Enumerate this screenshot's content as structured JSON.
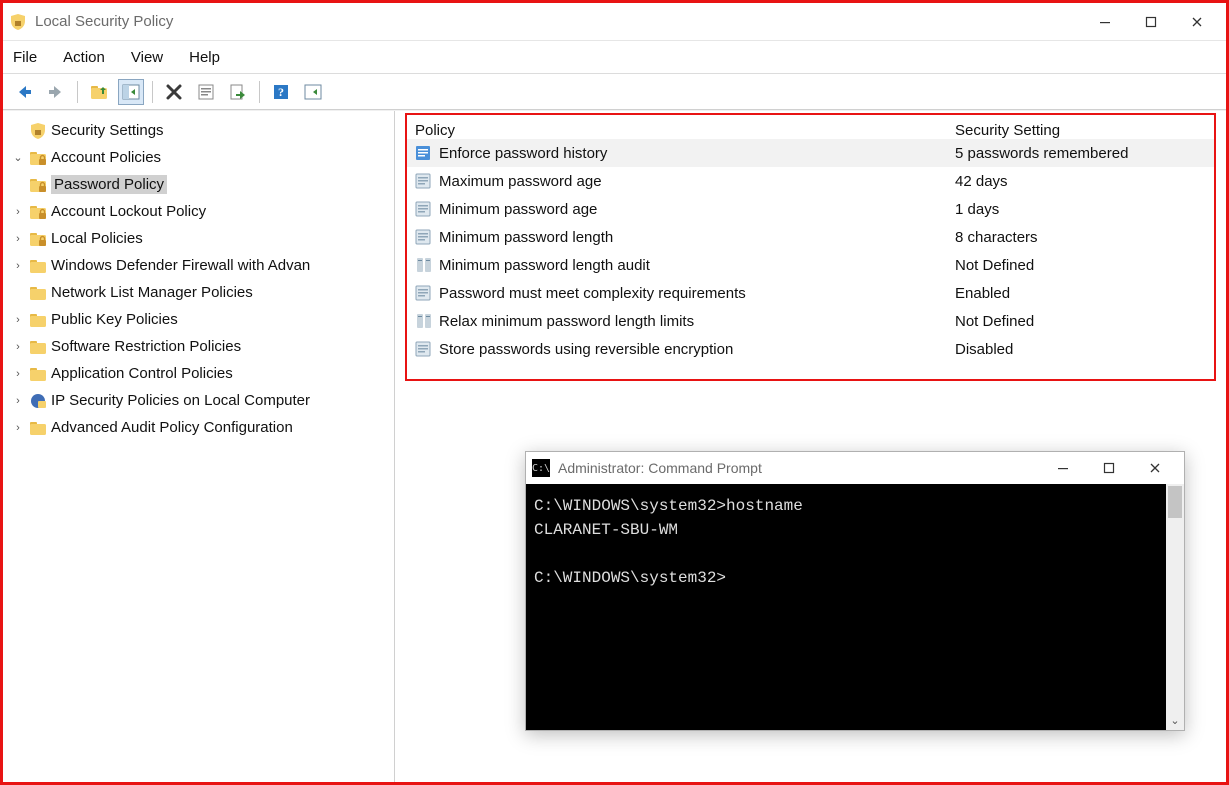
{
  "title": "Local Security Policy",
  "menu": {
    "file": "File",
    "action": "Action",
    "view": "View",
    "help": "Help"
  },
  "win_controls": {
    "min": "Minimize",
    "max": "Maximize",
    "close": "Close"
  },
  "tree": {
    "root": "Security Settings",
    "account_policies": "Account Policies",
    "password_policy": "Password Policy",
    "account_lockout": "Account Lockout Policy",
    "local_policies": "Local Policies",
    "defender": "Windows Defender Firewall with Advan",
    "network_list": "Network List Manager Policies",
    "public_key": "Public Key Policies",
    "software_restriction": "Software Restriction Policies",
    "app_control": "Application Control Policies",
    "ipsec": "IP Security Policies on Local Computer",
    "adv_audit": "Advanced Audit Policy Configuration"
  },
  "grid": {
    "header_policy": "Policy",
    "header_setting": "Security Setting",
    "rows": [
      {
        "name": "Enforce password history",
        "value": "5 passwords remembered"
      },
      {
        "name": "Maximum password age",
        "value": "42 days"
      },
      {
        "name": "Minimum password age",
        "value": "1 days"
      },
      {
        "name": "Minimum password length",
        "value": "8 characters"
      },
      {
        "name": "Minimum password length audit",
        "value": "Not Defined"
      },
      {
        "name": "Password must meet complexity requirements",
        "value": "Enabled"
      },
      {
        "name": "Relax minimum password length limits",
        "value": "Not Defined"
      },
      {
        "name": "Store passwords using reversible encryption",
        "value": "Disabled"
      }
    ]
  },
  "cmd": {
    "title": "Administrator: Command Prompt",
    "lines": "C:\\WINDOWS\\system32>hostname\nCLARANET-SBU-WM\n\nC:\\WINDOWS\\system32>"
  }
}
